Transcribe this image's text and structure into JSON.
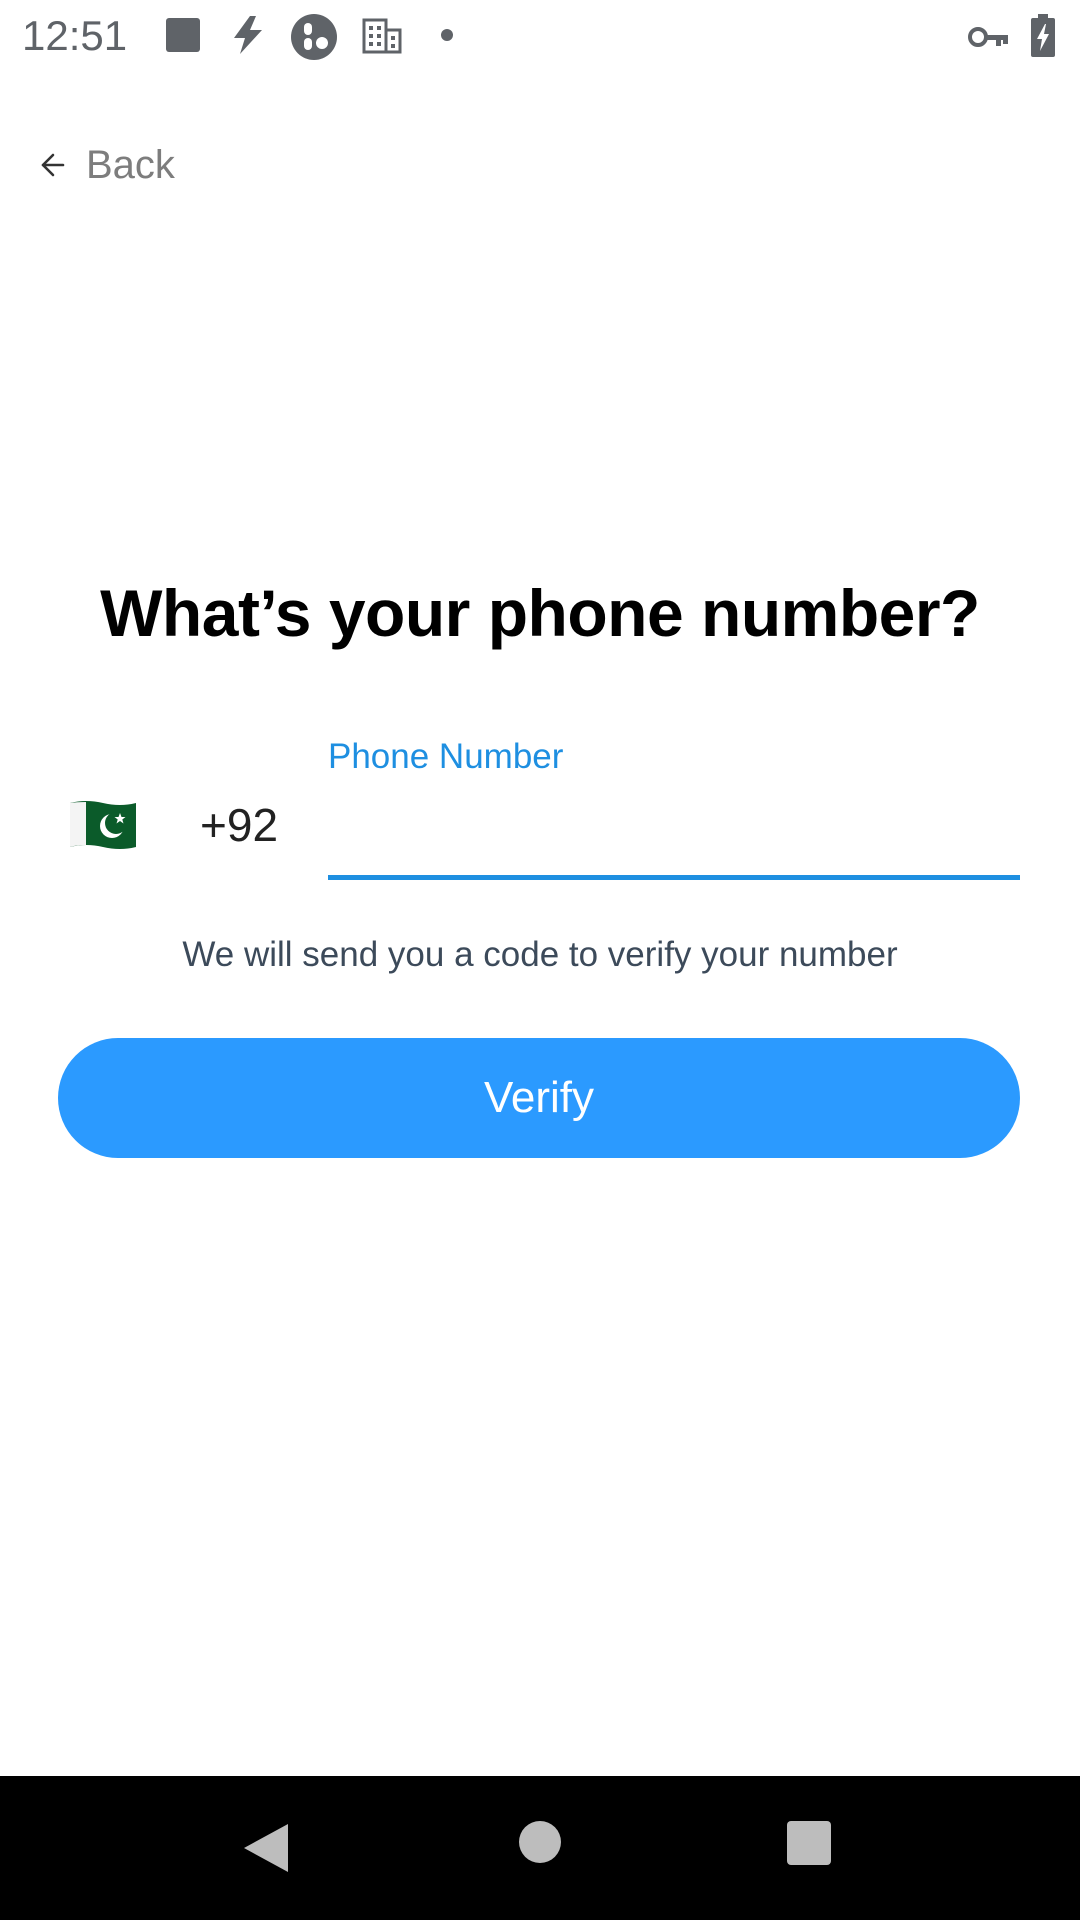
{
  "status_bar": {
    "time": "12:51",
    "icons": [
      "square-notification-icon",
      "lightning-icon",
      "assistant-app-icon",
      "building-icon",
      "dot-icon",
      "vpn-key-icon",
      "battery-charging-icon"
    ]
  },
  "header": {
    "back_label": "Back"
  },
  "main": {
    "title": "What’s your phone number?",
    "country_flag": "pakistan-flag-icon",
    "country_code": "+92",
    "phone_label": "Phone Number",
    "phone_value": "",
    "hint": "We will send you a code to verify your number",
    "verify_label": "Verify"
  },
  "colors": {
    "accent": "#1e8fe1",
    "button": "#2b9aff",
    "title": "#000000",
    "hint": "#3c4a5a",
    "nav_bar": "#000000"
  },
  "nav_bar": {
    "items": [
      "back-nav-icon",
      "home-nav-icon",
      "recents-nav-icon"
    ]
  }
}
